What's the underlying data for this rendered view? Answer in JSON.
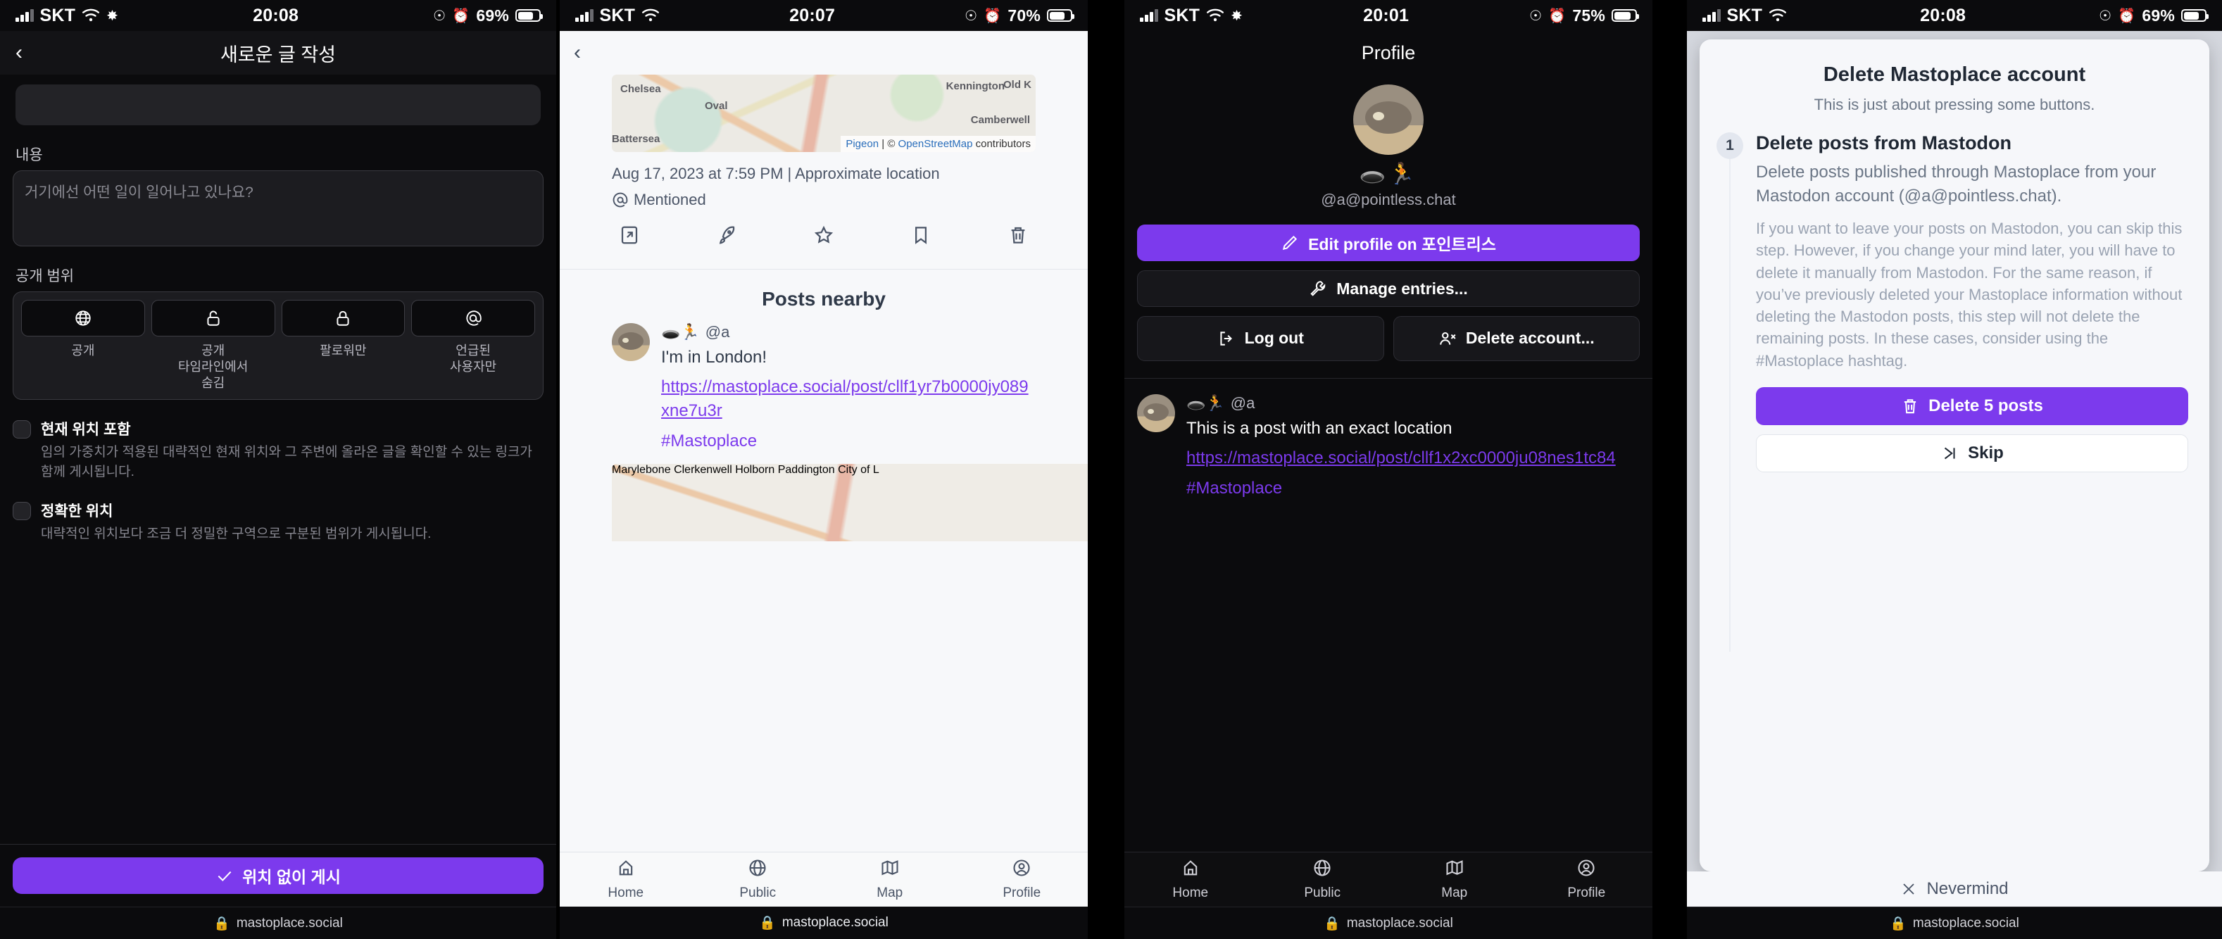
{
  "panels": {
    "compose": {
      "status": {
        "carrier": "SKT",
        "time": "20:08",
        "battery_pct": "69%"
      },
      "nav": {
        "back": "‹",
        "title": "새로운 글 작성"
      },
      "content_label": "내용",
      "content_placeholder": "거기에선 어떤 일이 일어나고 있나요?",
      "visibility_label": "공개 범위",
      "visibility_options": [
        {
          "icon": "globe-icon",
          "label": "공개"
        },
        {
          "icon": "unlock-icon",
          "label": "공개\n타임라인에서\n숨김"
        },
        {
          "icon": "lock-icon",
          "label": "팔로워만"
        },
        {
          "icon": "at-icon",
          "label": "언급된\n사용자만"
        }
      ],
      "checkboxes": [
        {
          "title": "현재 위치 포함",
          "desc": "임의 가중치가 적용된 대략적인 현재 위치와 그 주변에 올라온 글을 확인할 수 있는 링크가 함께 게시됩니다."
        },
        {
          "title": "정확한 위치",
          "desc": "대략적인 위치보다 조금 더 정밀한 구역으로 구분된 범위가 게시됩니다."
        }
      ],
      "submit_label": "위치 없이 게시",
      "footer_domain": "mastoplace.social"
    },
    "post_detail": {
      "status": {
        "carrier": "SKT",
        "time": "20:07",
        "battery_pct": "70%"
      },
      "map_labels": [
        "Chelsea",
        "Kennington",
        "Old K",
        "Oval",
        "Camberwell",
        "Battersea"
      ],
      "map_attrib": {
        "provider": "Pigeon",
        "sep": "|",
        "copyright": "©",
        "osm": "OpenStreetMap",
        "suffix": "contributors"
      },
      "meta": "Aug 17, 2023 at 7:59 PM | Approximate location",
      "mention": "Mentioned",
      "actions": [
        "open-external-icon",
        "boost-icon",
        "favourite-icon",
        "bookmark-icon",
        "delete-icon"
      ],
      "nearby_title": "Posts nearby",
      "post": {
        "handle": "@a",
        "emoji": "🕳️🏃",
        "text": "I'm in London!",
        "link": "https://mastoplace.social/post/cllf1yr7b0000jy089xne7u3r",
        "tag": "#Mastoplace"
      },
      "map2_labels": [
        "Marylebone",
        "Clerkenwell",
        "Holborn",
        "Paddington",
        "City of L"
      ],
      "tabs": [
        {
          "label": "Home",
          "icon": "home-icon",
          "active": false
        },
        {
          "label": "Public",
          "icon": "globe-icon",
          "active": false
        },
        {
          "label": "Map",
          "icon": "map-icon",
          "active": false
        },
        {
          "label": "Profile",
          "icon": "person-icon",
          "active": false
        }
      ],
      "footer_domain": "mastoplace.social"
    },
    "profile": {
      "status": {
        "carrier": "SKT",
        "time": "20:01",
        "battery_pct": "75%"
      },
      "nav_title": "Profile",
      "emoji": "🕳️🏃",
      "handle": "@a@pointless.chat",
      "buttons": {
        "edit_profile": "Edit profile on 포인트리스",
        "manage_entries": "Manage entries...",
        "log_out": "Log out",
        "delete_account": "Delete account..."
      },
      "post": {
        "handle": "@a",
        "emoji": "🕳️🏃",
        "text": "This is a post with an exact location",
        "link": "https://mastoplace.social/post/cllf1x2xc0000ju08nes1tc84",
        "tag": "#Mastoplace"
      },
      "tabs": [
        {
          "label": "Home",
          "icon": "home-icon",
          "active": false
        },
        {
          "label": "Public",
          "icon": "globe-icon",
          "active": false
        },
        {
          "label": "Map",
          "icon": "map-icon",
          "active": false
        },
        {
          "label": "Profile",
          "icon": "person-icon",
          "active": true
        }
      ],
      "footer_domain": "mastoplace.social"
    },
    "delete_dialog": {
      "status": {
        "carrier": "SKT",
        "time": "20:08",
        "battery_pct": "69%"
      },
      "title": "Delete Mastoplace account",
      "subtitle": "This is just about pressing some buttons.",
      "step_number": "1",
      "step_title": "Delete posts from Mastodon",
      "step_body": "Delete posts published through Mastoplace from your Mastodon account (@a@pointless.chat).",
      "step_note": "If you want to leave your posts on Mastodon, you can skip this step. However, if you change your mind later, you will have to delete it manually from Mastodon. For the same reason, if you’ve previously deleted your Mastoplace information without deleting the Mastodon posts, this step will not delete the remaining posts. In these cases, consider using the #Mastoplace hashtag.",
      "delete_label": "Delete 5 posts",
      "skip_label": "Skip",
      "nevermind_label": "Nevermind",
      "footer_domain": "mastoplace.social"
    }
  },
  "colors": {
    "accent": "#7c3aed",
    "dark_bg": "#0b0b0d",
    "light_bg": "#f7f8fa"
  }
}
